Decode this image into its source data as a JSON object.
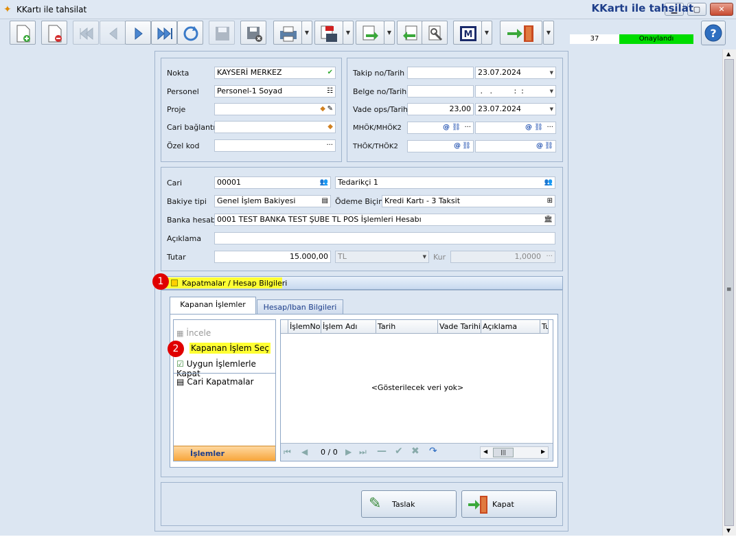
{
  "window": {
    "title": "KKartı ile tahsilat"
  },
  "header": {
    "title": "KKartı ile tahsilat",
    "number": "37",
    "status": "Onaylandı"
  },
  "form": {
    "nokta": {
      "label": "Nokta",
      "value": "KAYSERİ MERKEZ"
    },
    "personel": {
      "label": "Personel",
      "value": "Personel-1 Soyad"
    },
    "proje": {
      "label": "Proje",
      "value": ""
    },
    "cari_baglanti": {
      "label": "Cari bağlantı",
      "value": ""
    },
    "ozel_kod": {
      "label": "Özel kod",
      "value": ""
    },
    "takip": {
      "label": "Takip no/Tarih",
      "no": "",
      "date": "23.07.2024"
    },
    "belge": {
      "label": "Belge no/Tarih",
      "no": "",
      "date": " .   .         :  :"
    },
    "vade": {
      "label": "Vade ops/Tarih",
      "value": "23,00",
      "date": "23.07.2024"
    },
    "mhok": {
      "label": "MHÖK/MHÖK2"
    },
    "thok": {
      "label": "THÖK/THÖK2"
    },
    "cari": {
      "label": "Cari",
      "code": "00001",
      "name": "Tedarikçi 1"
    },
    "bakiye": {
      "label": "Bakiye tipi",
      "value": "Genel İşlem Bakiyesi"
    },
    "odeme": {
      "label": "Ödeme Biçimi",
      "value": "Kredi Kartı - 3 Taksit"
    },
    "banka": {
      "label": "Banka hesabı",
      "value": "0001 TEST BANKA TEST ŞUBE TL POS İşlemleri Hesabı"
    },
    "aciklama": {
      "label": "Açıklama",
      "value": ""
    },
    "tutar": {
      "label": "Tutar",
      "value": "15.000,00",
      "currency": "TL",
      "kur_label": "Kur",
      "kur": "1,0000"
    }
  },
  "section": {
    "title": "Kapatmalar / Hesap Bilgileri",
    "badge1": "1",
    "badge2": "2"
  },
  "tabs": [
    "Kapanan İşlemler",
    "Hesap/Iban Bilgileri"
  ],
  "sidebar": {
    "items": [
      "İncele",
      "Kapanan İşlem Seç",
      "Uygun İşlemlerle Kapat",
      "Cari Kapatmalar"
    ],
    "footer": "İşlemler"
  },
  "grid": {
    "columns": [
      "İşlemNo",
      "İşlem Adı",
      "Tarih",
      "Vade Tarihi",
      "Açıklama",
      "Tu"
    ],
    "empty": "<Gösterilecek veri yok>",
    "pager": "0 / 0"
  },
  "buttons": {
    "taslak": "Taslak",
    "kapat": "Kapat"
  }
}
